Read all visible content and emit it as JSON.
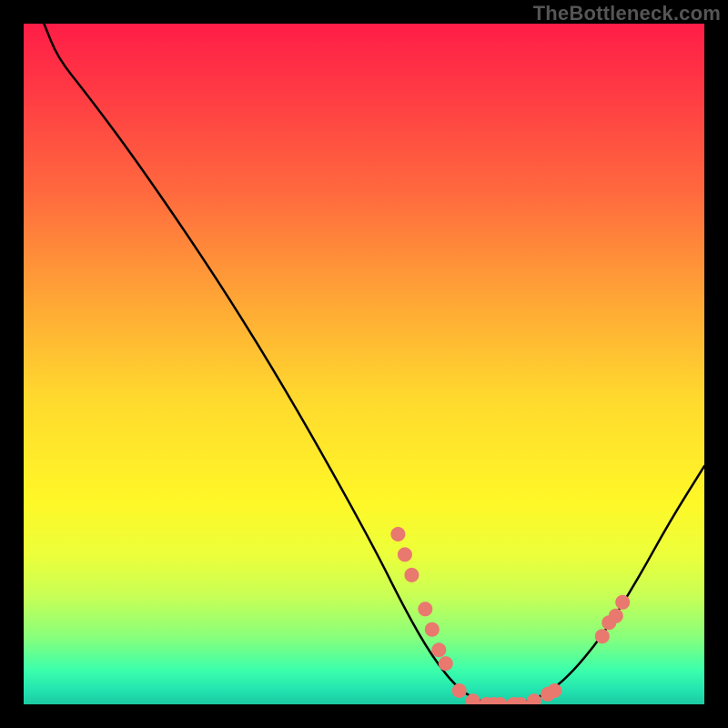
{
  "watermark": "TheBottleneck.com",
  "chart_data": {
    "type": "line",
    "title": "",
    "xlabel": "",
    "ylabel": "",
    "xlim": [
      0,
      100
    ],
    "ylim": [
      0,
      100
    ],
    "curve": {
      "name": "bottleneck-curve",
      "points": [
        {
          "x": 3,
          "y": 100
        },
        {
          "x": 5,
          "y": 95
        },
        {
          "x": 9,
          "y": 90
        },
        {
          "x": 15,
          "y": 82
        },
        {
          "x": 22,
          "y": 72
        },
        {
          "x": 30,
          "y": 60
        },
        {
          "x": 38,
          "y": 47
        },
        {
          "x": 46,
          "y": 33
        },
        {
          "x": 52,
          "y": 22
        },
        {
          "x": 56,
          "y": 14
        },
        {
          "x": 60,
          "y": 7
        },
        {
          "x": 64,
          "y": 2
        },
        {
          "x": 68,
          "y": 0
        },
        {
          "x": 72,
          "y": 0
        },
        {
          "x": 76,
          "y": 1
        },
        {
          "x": 80,
          "y": 4
        },
        {
          "x": 85,
          "y": 10
        },
        {
          "x": 90,
          "y": 18
        },
        {
          "x": 95,
          "y": 27
        },
        {
          "x": 100,
          "y": 35
        }
      ]
    },
    "markers": {
      "name": "data-points",
      "color": "#e9786f",
      "points": [
        {
          "x": 55,
          "y": 25
        },
        {
          "x": 56,
          "y": 22
        },
        {
          "x": 57,
          "y": 19
        },
        {
          "x": 59,
          "y": 14
        },
        {
          "x": 60,
          "y": 11
        },
        {
          "x": 61,
          "y": 8
        },
        {
          "x": 62,
          "y": 6
        },
        {
          "x": 64,
          "y": 2
        },
        {
          "x": 66,
          "y": 0.5
        },
        {
          "x": 68,
          "y": 0
        },
        {
          "x": 69,
          "y": 0
        },
        {
          "x": 70,
          "y": 0
        },
        {
          "x": 72,
          "y": 0
        },
        {
          "x": 73,
          "y": 0
        },
        {
          "x": 75,
          "y": 0.5
        },
        {
          "x": 77,
          "y": 1.5
        },
        {
          "x": 78,
          "y": 2
        },
        {
          "x": 85,
          "y": 10
        },
        {
          "x": 86,
          "y": 12
        },
        {
          "x": 87,
          "y": 13
        },
        {
          "x": 88,
          "y": 15
        }
      ]
    }
  }
}
